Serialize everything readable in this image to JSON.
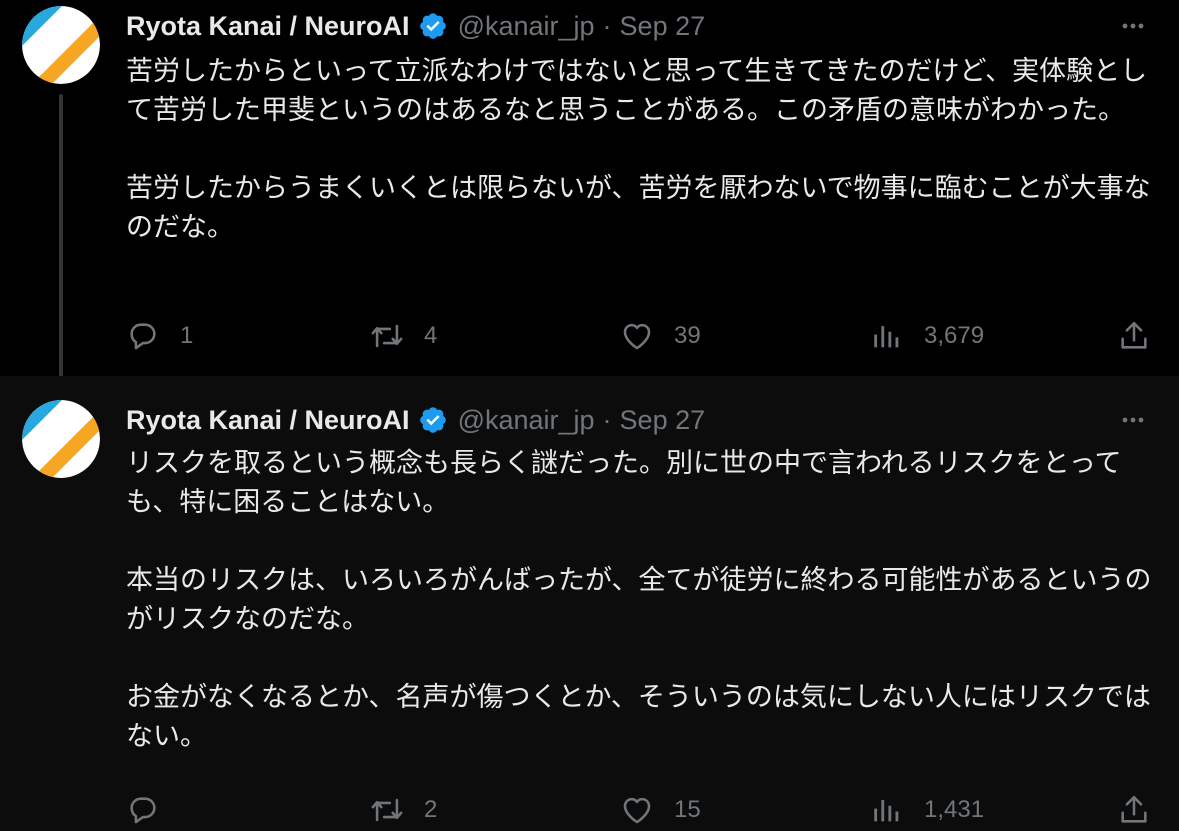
{
  "colors": {
    "background": "#000000",
    "text": "#e7e9ea",
    "secondary": "#71767b",
    "verified": "#1d9bf0",
    "avatar_blue": "#29a8e0",
    "avatar_orange": "#f5a623"
  },
  "tweets": [
    {
      "author": {
        "name": "Ryota Kanai / NeuroAI",
        "handle": "@kanair_jp",
        "separator": "·",
        "date": "Sep 27",
        "verified_icon": "verified-badge-icon"
      },
      "paragraphs": [
        "苦労したからといって立派なわけではないと思って生きてきたのだけど、実体験として苦労した甲斐というのはあるなと思うことがある。この矛盾の意味がわかった。",
        "苦労したからうまくいくとは限らないが、苦労を厭わないで物事に臨むことが大事なのだな。"
      ],
      "actions": {
        "replies": "1",
        "retweets": "4",
        "likes": "39",
        "views": "3,679"
      }
    },
    {
      "author": {
        "name": "Ryota Kanai / NeuroAI",
        "handle": "@kanair_jp",
        "separator": "·",
        "date": "Sep 27",
        "verified_icon": "verified-badge-icon"
      },
      "paragraphs": [
        "リスクを取るという概念も長らく謎だった。別に世の中で言われるリスクをとっても、特に困ることはない。",
        "本当のリスクは、いろいろがんばったが、全てが徒労に終わる可能性があるというのがリスクなのだな。",
        "お金がなくなるとか、名声が傷つくとか、そういうのは気にしない人にはリスクではない。"
      ],
      "actions": {
        "replies": "",
        "retweets": "2",
        "likes": "15",
        "views": "1,431"
      }
    }
  ]
}
